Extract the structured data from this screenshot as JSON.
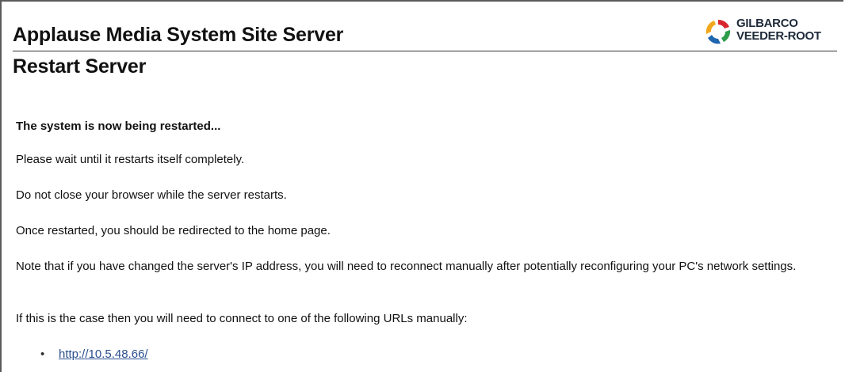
{
  "header": {
    "site_title": "Applause Media System Site Server",
    "page_title": "Restart Server",
    "logo": {
      "line1": "GILBARCO",
      "line2": "VEEDER-ROOT",
      "icon": "gilbarco-logo-icon",
      "colors": [
        "#d7262e",
        "#2e9d4a",
        "#1f66b0",
        "#f2a81d"
      ]
    }
  },
  "content": {
    "status_heading": "The system is now being restarted...",
    "messages": [
      "Please wait until it restarts itself completely.",
      "Do not close your browser while the server restarts.",
      "Once restarted, you should be redirected to the home page.",
      "Note that if you have changed the server's IP address, you will need to reconnect manually after potentially reconfiguring your PC's network settings.",
      "If this is the case then you will need to connect to one of the following URLs manually:"
    ],
    "urls": [
      "http://10.5.48.66/"
    ]
  },
  "colors": {
    "text": "#111111",
    "link": "#2a4f8f",
    "rule": "#333333"
  }
}
